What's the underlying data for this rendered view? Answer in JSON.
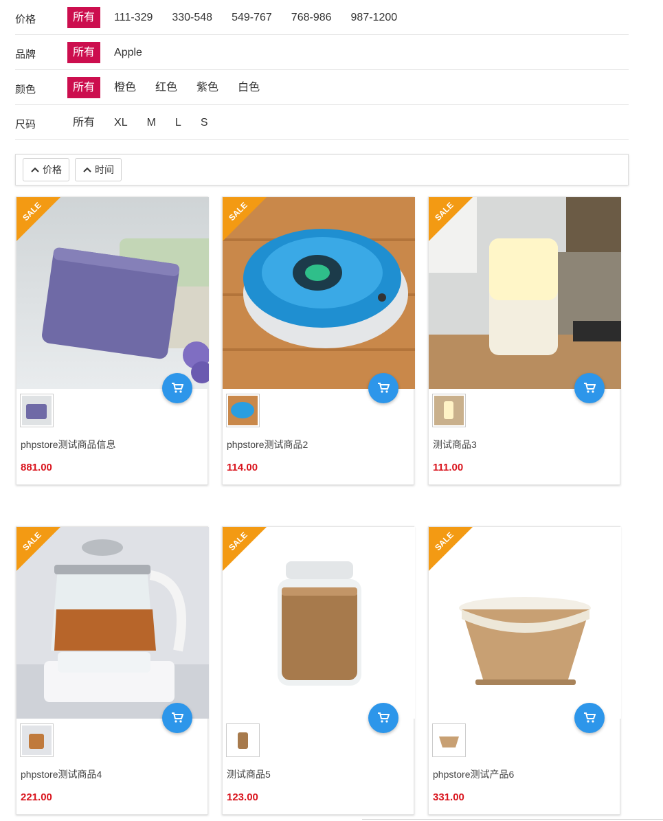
{
  "filters": [
    {
      "label": "价格",
      "options": [
        "所有",
        "111-329",
        "330-548",
        "549-767",
        "768-986",
        "987-1200"
      ],
      "active": 0
    },
    {
      "label": "品牌",
      "options": [
        "所有",
        "Apple"
      ],
      "active": 0
    },
    {
      "label": "颜色",
      "options": [
        "所有",
        "橙色",
        "红色",
        "紫色",
        "白色"
      ],
      "active": 0
    },
    {
      "label": "尺码",
      "options": [
        "所有",
        "XL",
        "M",
        "L",
        "S"
      ],
      "active": -1
    }
  ],
  "sort": [
    {
      "label": "价格",
      "icon": "chevron-up-icon"
    },
    {
      "label": "时间",
      "icon": "chevron-up-icon"
    }
  ],
  "ribbon_text": "SALE",
  "colors": {
    "accent": "#cc0e4e",
    "price": "#d9141d",
    "cart": "#2d96ea",
    "ribbon": "#f39a13"
  },
  "products": [
    {
      "name": "phpstore测试商品信息",
      "price": "881.00",
      "image": "lavender-soap"
    },
    {
      "name": "phpstore测试商品2",
      "price": "114.00",
      "image": "robot-vacuum"
    },
    {
      "name": "测试商品3",
      "price": "111.00",
      "image": "aroma-diffuser-lamp"
    },
    {
      "name": "phpstore测试商品4",
      "price": "221.00",
      "image": "glass-tea-kettle"
    },
    {
      "name": "测试商品5",
      "price": "123.00",
      "image": "pasta-glass-jar"
    },
    {
      "name": "phpstore测试产品6",
      "price": "331.00",
      "image": "wooden-storage-basket"
    }
  ]
}
